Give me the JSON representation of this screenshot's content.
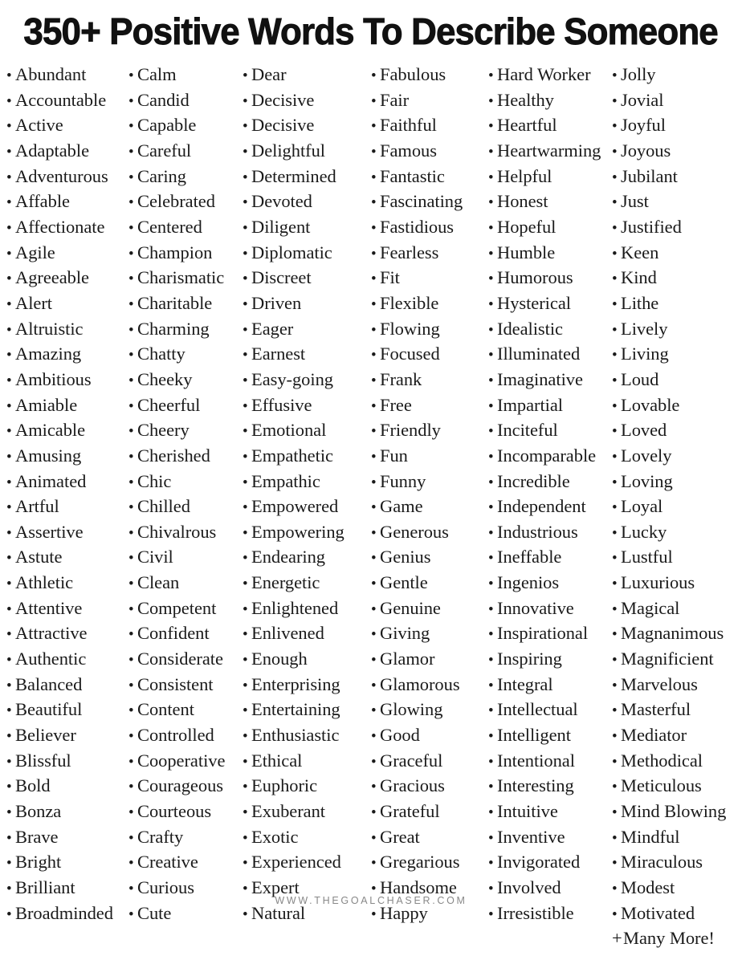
{
  "header": {
    "title": "350+ Positive Words To Describe Someone"
  },
  "footer": {
    "website": "WWW.THEGOALCHASER.COM"
  },
  "style": {
    "background_color": "#ffffff",
    "text_color": "#1a1a1a",
    "title_color": "#111111",
    "footer_color": "#888888",
    "bullet_glyph": "•",
    "more_prefix": "+"
  },
  "columns": [
    {
      "index": 1,
      "items": [
        "Abundant",
        "Accountable",
        "Active",
        "Adaptable",
        "Adventurous",
        "Affable",
        "Affectionate",
        "Agile",
        "Agreeable",
        "Alert",
        "Altruistic",
        "Amazing",
        "Ambitious",
        "Amiable",
        "Amicable",
        "Amusing",
        "Animated",
        "Artful",
        "Assertive",
        "Astute",
        "Athletic",
        "Attentive",
        "Attractive",
        "Authentic",
        "Balanced",
        "Beautiful",
        "Believer",
        "Blissful",
        "Bold",
        "Bonza",
        "Brave",
        "Bright",
        "Brilliant",
        "Broadminded"
      ]
    },
    {
      "index": 2,
      "items": [
        "Calm",
        "Candid",
        "Capable",
        "Careful",
        "Caring",
        "Celebrated",
        "Centered",
        "Champion",
        "Charismatic",
        "Charitable",
        "Charming",
        "Chatty",
        "Cheeky",
        "Cheerful",
        "Cheery",
        "Cherished",
        "Chic",
        "Chilled",
        "Chivalrous",
        "Civil",
        "Clean",
        "Competent",
        "Confident",
        "Considerate",
        "Consistent",
        "Content",
        "Controlled",
        "Cooperative",
        "Courageous",
        "Courteous",
        "Crafty",
        "Creative",
        "Curious",
        "Cute"
      ]
    },
    {
      "index": 3,
      "items": [
        "Dear",
        "Decisive",
        "Decisive",
        "Delightful",
        "Determined",
        "Devoted",
        "Diligent",
        "Diplomatic",
        "Discreet",
        "Driven",
        "Eager",
        "Earnest",
        "Easy-going",
        "Effusive",
        "Emotional",
        "Empathetic",
        "Empathic",
        "Empowered",
        "Empowering",
        "Endearing",
        "Energetic",
        "Enlightened",
        "Enlivened",
        "Enough",
        "Enterprising",
        "Entertaining",
        "Enthusiastic",
        "Ethical",
        "Euphoric",
        "Exuberant",
        "Exotic",
        "Experienced",
        "Expert",
        "Natural"
      ]
    },
    {
      "index": 4,
      "items": [
        "Fabulous",
        "Fair",
        "Faithful",
        "Famous",
        "Fantastic",
        "Fascinating",
        "Fastidious",
        "Fearless",
        "Fit",
        "Flexible",
        "Flowing",
        "Focused",
        "Frank",
        "Free",
        "Friendly",
        "Fun",
        "Funny",
        "Game",
        "Generous",
        "Genius",
        "Gentle",
        "Genuine",
        "Giving",
        "Glamor",
        "Glamorous",
        "Glowing",
        "Good",
        "Graceful",
        "Gracious",
        "Grateful",
        "Great",
        "Gregarious",
        "Handsome",
        "Happy"
      ]
    },
    {
      "index": 5,
      "items": [
        "Hard Worker",
        "Healthy",
        "Heartful",
        "Heartwarming",
        "Helpful",
        "Honest",
        "Hopeful",
        "Humble",
        "Humorous",
        "Hysterical",
        "Idealistic",
        "Illuminated",
        "Imaginative",
        "Impartial",
        "Inciteful",
        "Incomparable",
        "Incredible",
        "Independent",
        "Industrious",
        "Ineffable",
        "Ingenios",
        "Innovative",
        "Inspirational",
        "Inspiring",
        "Integral",
        "Intellectual",
        "Intelligent",
        "Intentional",
        "Interesting",
        "Intuitive",
        "Inventive",
        "Invigorated",
        "Involved",
        "Irresistible"
      ]
    },
    {
      "index": 6,
      "items": [
        "Jolly",
        "Jovial",
        "Joyful",
        "Joyous",
        "Jubilant",
        "Just",
        "Justified",
        "Keen",
        "Kind",
        "Lithe",
        "Lively",
        "Living",
        "Loud",
        "Lovable",
        "Loved",
        "Lovely",
        "Loving",
        "Loyal",
        "Lucky",
        "Lustful",
        "Luxurious",
        "Magical",
        "Magnanimous",
        "Magnificient",
        "Marvelous",
        "Masterful",
        "Mediator",
        "Methodical",
        "Meticulous",
        "Mind Blowing",
        "Mindful",
        "Miraculous",
        "Modest",
        "Motivated"
      ],
      "trailing_note": "Many More!"
    }
  ]
}
